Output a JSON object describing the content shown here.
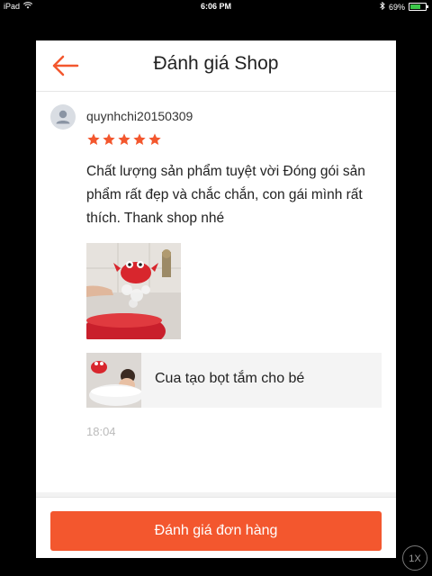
{
  "status_bar": {
    "device": "iPad",
    "time": "6:06 PM",
    "battery": "69%",
    "battery_level": 0.69,
    "wifi_icon": "wifi-icon",
    "battery_icon": "battery-icon"
  },
  "header": {
    "title": "Đánh giá Shop",
    "back_icon": "back-arrow-icon",
    "accent_color": "#f3572e"
  },
  "review": {
    "username": "quynhchi20150309",
    "rating": 5,
    "max_rating": 5,
    "star_color": "#f3572e",
    "text": "Chất lượng sản phẩm tuyệt vời Đóng gói sản phẩm rất đẹp và chắc chắn, con gái mình rất thích. Thank shop nhé",
    "time": "18:04",
    "product": {
      "name": "Cua tạo bọt tắm cho bé"
    }
  },
  "footer": {
    "button_label": "Đánh giá đơn hàng",
    "button_color": "#f3572e"
  },
  "zoom_badge": "1X"
}
